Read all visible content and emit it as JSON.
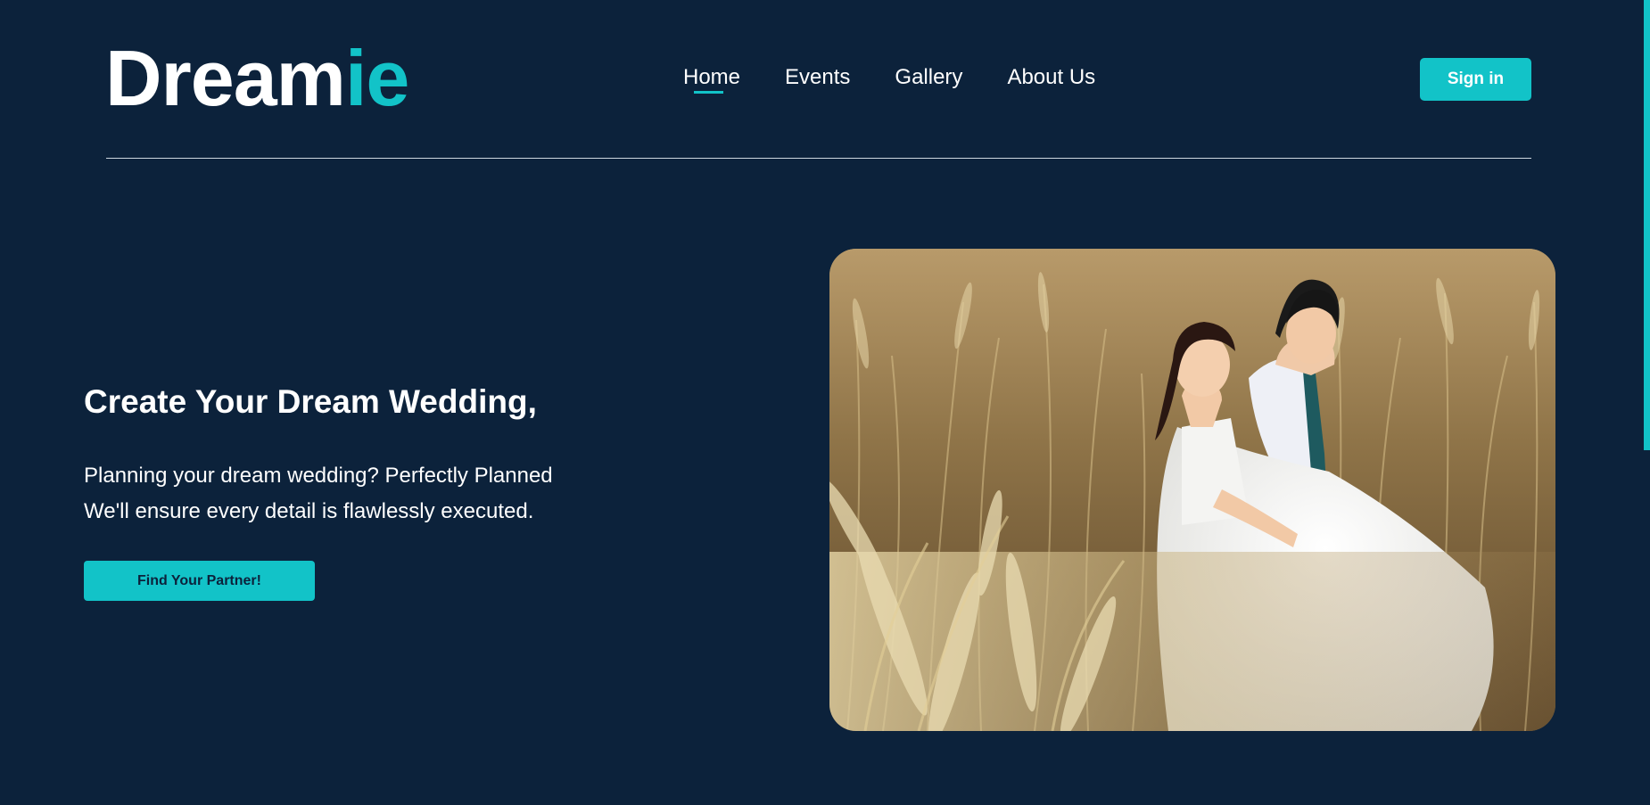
{
  "brand": {
    "name_main": "Dream",
    "name_accent": "ie",
    "accent_color": "#12c3c8",
    "background_color": "#0c223b"
  },
  "nav": {
    "items": [
      {
        "label": "Home",
        "active": true
      },
      {
        "label": "Events",
        "active": false
      },
      {
        "label": "Gallery",
        "active": false
      },
      {
        "label": "About Us",
        "active": false
      }
    ]
  },
  "header": {
    "signin_label": "Sign in"
  },
  "hero": {
    "title": "Create Your Dream Wedding,",
    "line1": "Planning your dream wedding? Perfectly Planned",
    "line2": "We'll ensure every detail is flawlessly executed.",
    "cta_label": "Find Your Partner!",
    "image": {
      "subject": "couple-in-tall-grass-photo"
    }
  }
}
